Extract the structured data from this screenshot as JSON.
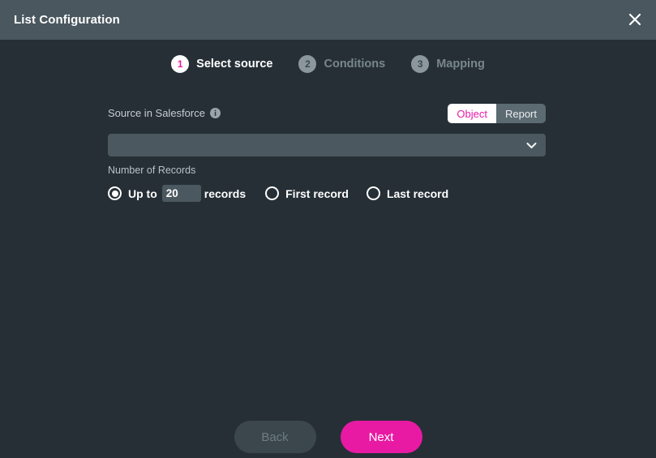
{
  "window": {
    "title": "List Configuration",
    "close_icon": "close-icon"
  },
  "stepper": {
    "steps": [
      {
        "number": "1",
        "label": "Select source",
        "state": "active"
      },
      {
        "number": "2",
        "label": "Conditions",
        "state": "inactive"
      },
      {
        "number": "3",
        "label": "Mapping",
        "state": "inactive"
      }
    ]
  },
  "form": {
    "source_label": "Source in Salesforce",
    "info_icon": "info-icon",
    "source_type_toggle": {
      "options": [
        "Object",
        "Report"
      ],
      "selected": "Object"
    },
    "source_select": {
      "value": "",
      "placeholder": "",
      "caret_icon": "chevron-down-icon"
    },
    "records_label": "Number of Records",
    "records_options": [
      {
        "id": "up-to",
        "label_before": "Up to",
        "value": "20",
        "label_after": "records",
        "selected": true
      },
      {
        "id": "first-record",
        "label": "First record",
        "selected": false
      },
      {
        "id": "last-record",
        "label": "Last record",
        "selected": false
      }
    ]
  },
  "footer": {
    "back_label": "Back",
    "next_label": "Next"
  },
  "colors": {
    "accent": "#e81aa4",
    "titlebar": "#4a575f",
    "body": "#262f36",
    "field": "#4b585f",
    "muted_text": "#79868d"
  }
}
